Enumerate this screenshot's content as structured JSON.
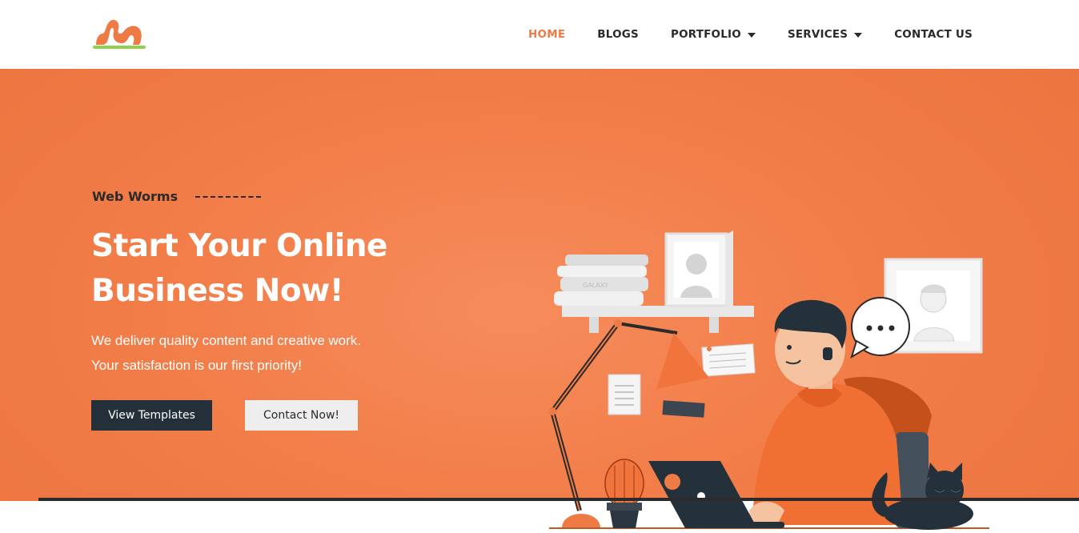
{
  "nav": {
    "items": [
      {
        "label": "HOME",
        "active": true
      },
      {
        "label": "BLOGS"
      },
      {
        "label": "PORTFOLIO",
        "dropdown": true
      },
      {
        "label": "SERVICES",
        "dropdown": true
      },
      {
        "label": "CONTACT US"
      }
    ]
  },
  "hero": {
    "eyebrow": "Web Worms",
    "headline_line1": "Start Your Online",
    "headline_line2": "Business Now!",
    "sub_line1": "We deliver quality content and creative work.",
    "sub_line2": "Your satisfaction is our first priority!",
    "primary_button": "View Templates",
    "secondary_button": "Contact Now!",
    "book_spine_text": "GALAXY"
  },
  "colors": {
    "accent": "#ee7a46",
    "hero_bg": "#f27e4a",
    "dark": "#23303a"
  }
}
